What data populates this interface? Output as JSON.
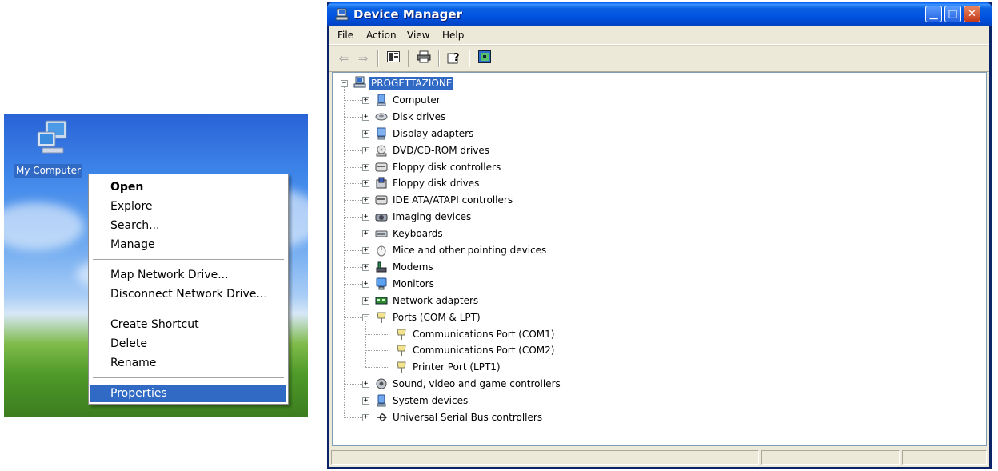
{
  "desktop": {
    "icon_label": "My Computer",
    "context_menu": [
      {
        "label": "Open",
        "bold": true
      },
      {
        "label": "Explore"
      },
      {
        "label": "Search..."
      },
      {
        "label": "Manage"
      },
      {
        "label": "Map Network Drive..."
      },
      {
        "label": "Disconnect Network Drive..."
      },
      {
        "label": "Create Shortcut"
      },
      {
        "label": "Delete"
      },
      {
        "label": "Rename"
      },
      {
        "label": "Properties",
        "selected": true
      }
    ]
  },
  "window": {
    "title": "Device Manager",
    "menu": [
      "File",
      "Action",
      "View",
      "Help"
    ],
    "toolbar_icons": [
      "back-arrow-icon",
      "forward-arrow-icon",
      "show-hide-console-tree-icon",
      "print-icon",
      "help-icon",
      "scan-hardware-icon"
    ],
    "tree": {
      "root": "PROGETTAZIONE",
      "categories": [
        {
          "label": "Computer",
          "icon": "computer-icon"
        },
        {
          "label": "Disk drives",
          "icon": "disk-drive-icon"
        },
        {
          "label": "Display adapters",
          "icon": "display-adapter-icon"
        },
        {
          "label": "DVD/CD-ROM drives",
          "icon": "cdrom-icon"
        },
        {
          "label": "Floppy disk controllers",
          "icon": "controller-icon"
        },
        {
          "label": "Floppy disk drives",
          "icon": "floppy-icon"
        },
        {
          "label": "IDE ATA/ATAPI controllers",
          "icon": "ide-controller-icon"
        },
        {
          "label": "Imaging devices",
          "icon": "camera-icon"
        },
        {
          "label": "Keyboards",
          "icon": "keyboard-icon"
        },
        {
          "label": "Mice and other pointing devices",
          "icon": "mouse-icon"
        },
        {
          "label": "Modems",
          "icon": "modem-icon"
        },
        {
          "label": "Monitors",
          "icon": "monitor-icon"
        },
        {
          "label": "Network adapters",
          "icon": "network-adapter-icon"
        },
        {
          "label": "Ports (COM & LPT)",
          "icon": "port-icon",
          "expanded": true,
          "children": [
            "Communications Port (COM1)",
            "Communications Port (COM2)",
            "Printer Port (LPT1)"
          ]
        },
        {
          "label": "Sound, video and game controllers",
          "icon": "sound-icon"
        },
        {
          "label": "System devices",
          "icon": "system-icon"
        },
        {
          "label": "Universal Serial Bus controllers",
          "icon": "usb-icon"
        }
      ]
    }
  }
}
